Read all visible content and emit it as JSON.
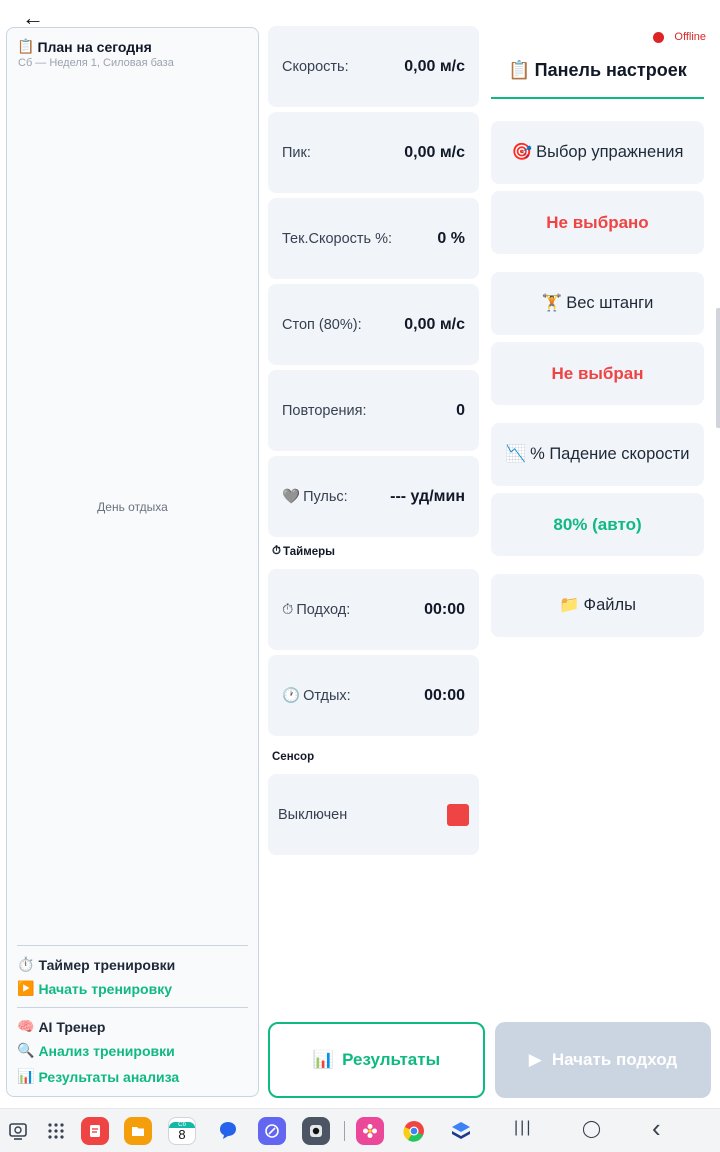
{
  "header": {
    "back_label": "←"
  },
  "status": {
    "offline_label": "Offline",
    "offline_color": "#dc2626"
  },
  "plan": {
    "title_icon": "📋",
    "title": "План на сегодня",
    "subtitle": "Сб — Неделя 1, Силовая база",
    "rest_day": "День отдыха",
    "timer_section": {
      "icon": "⏱️",
      "label": "Таймер тренировки"
    },
    "start_workout": {
      "icon": "▶️",
      "label": "Начать тренировку"
    },
    "ai_section": {
      "icon": "🧠",
      "label": "AI Тренер"
    },
    "analysis": {
      "icon": "🔍",
      "label": "Анализ тренировки"
    },
    "analysis_results": {
      "icon": "📊",
      "label": "Результаты анализа"
    }
  },
  "metrics": [
    {
      "label": "Скорость:",
      "value": "0,00 м/с"
    },
    {
      "label": "Пик:",
      "value": "0,00 м/с"
    },
    {
      "label": "Тек.Скорость %:",
      "value": "0 %"
    },
    {
      "label": "Стоп (80%):",
      "value": "0,00 м/с"
    },
    {
      "label": "Повторения:",
      "value": "0"
    },
    {
      "icon": "🩶",
      "label": "Пульс:",
      "value": "--- уд/мин"
    }
  ],
  "timers": {
    "section_icon": "⏱",
    "section_label": "Таймеры",
    "set": {
      "icon": "⏱",
      "label": "Подход:",
      "value": "00:00"
    },
    "rest": {
      "icon": "🕐",
      "label": "Отдых:",
      "value": "00:00"
    }
  },
  "sensor": {
    "section_label": "Сенсор",
    "state_label": "Выключен",
    "indicator_color": "#ef4444"
  },
  "settings": {
    "title_icon": "📋",
    "title": "Панель настроек",
    "exercise": {
      "icon": "🎯",
      "label": "Выбор упражнения",
      "value": "Не выбрано"
    },
    "barbell": {
      "icon": "🏋️",
      "label": "Вес штанги",
      "value": "Не выбран"
    },
    "velocity_drop": {
      "icon": "📉",
      "label": "% Падение скорости",
      "value": "80% (авто)"
    },
    "files": {
      "icon": "📁",
      "label": "Файлы"
    }
  },
  "actions": {
    "results": {
      "icon": "📊",
      "label": "Результаты"
    },
    "start_set": {
      "icon": "▶",
      "label": "Начать подход"
    }
  },
  "taskbar": {
    "calendar_day_label": "Сб",
    "calendar_day_number": "8",
    "nav_recents": "|||",
    "nav_home": "◯",
    "nav_back": "‹"
  },
  "colors": {
    "accent": "#10b981",
    "warning": "#ef4444",
    "card_bg": "#f1f5f9",
    "disabled": "#cbd5e1"
  }
}
